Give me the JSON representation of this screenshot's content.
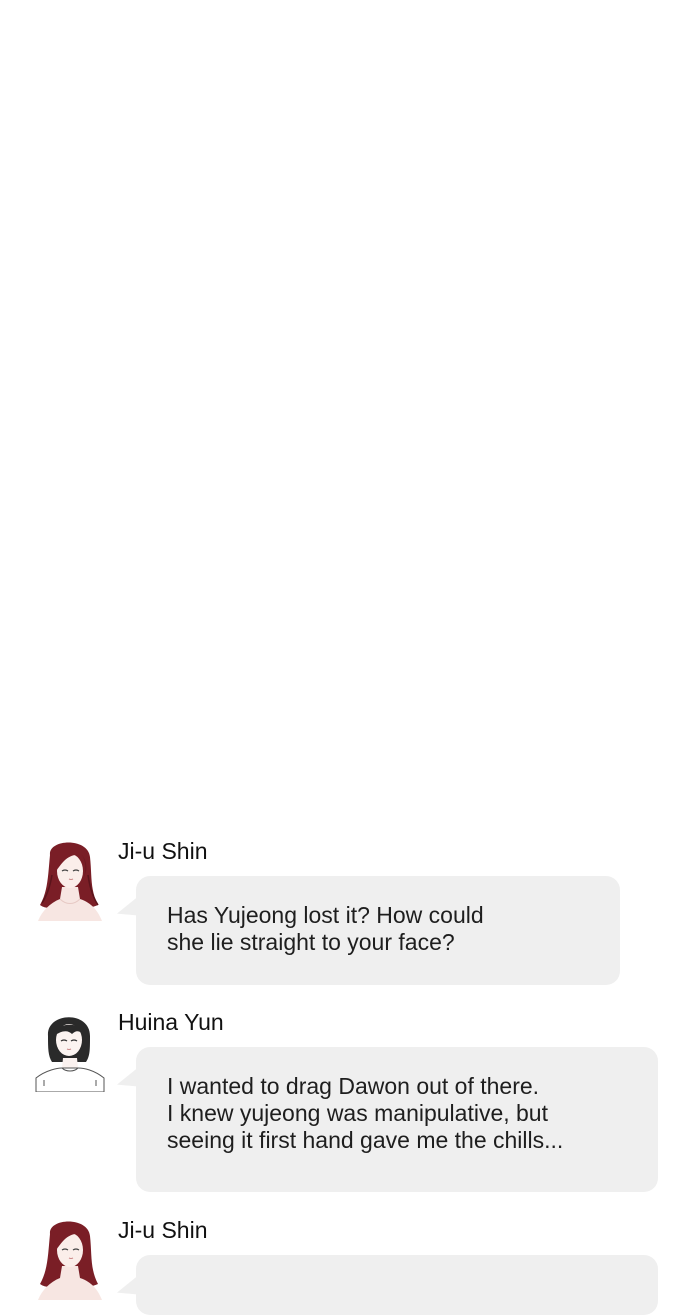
{
  "conversation": {
    "messages": [
      {
        "sender": "Ji-u Shin",
        "avatar_icon": "ji-u-shin-portrait-icon",
        "lines": [
          "Has Yujeong lost it? How could",
          "she lie straight to your face?"
        ]
      },
      {
        "sender": "Huina Yun",
        "avatar_icon": "huina-yun-portrait-icon",
        "lines": [
          "I wanted to drag Dawon out of there.",
          "I knew yujeong was manipulative, but",
          "seeing it first hand gave me the chills..."
        ]
      },
      {
        "sender": "Ji-u Shin",
        "avatar_icon": "ji-u-shin-portrait-icon",
        "lines": []
      }
    ]
  },
  "colors": {
    "background": "#ffffff",
    "bubble": "#efefef",
    "text": "#1e1e1e",
    "jiu_hair": "#7a1e26",
    "huina_hair": "#2a2a2a"
  }
}
